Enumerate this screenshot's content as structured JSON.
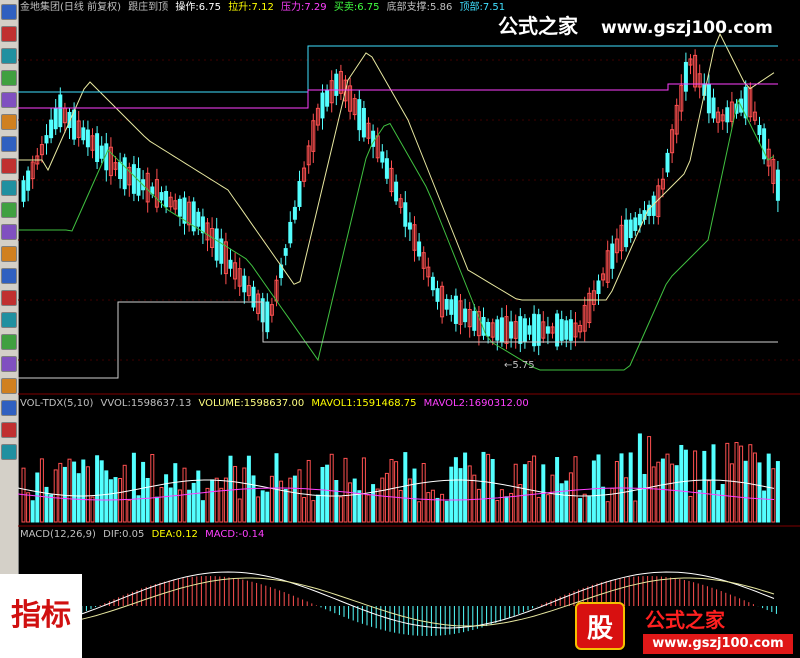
{
  "toolbar": {
    "icons": [
      "candlestick-icon",
      "trend-icon",
      "kline-icon",
      "bar-icon",
      "table-icon",
      "grid-icon",
      "note-icon",
      "people-icon",
      "chart-icon",
      "f10-icon",
      "report-icon",
      "info-icon",
      "news-icon",
      "sort-icon",
      "list-icon",
      "dollar-icon",
      "tools-icon",
      "exit-icon",
      "login-icon",
      "arrow-up-icon",
      "arrow-down-icon"
    ]
  },
  "main_header": {
    "stock": "金地集团(日线 前复权)",
    "indicator": "跟庄到顶",
    "operate": "操作:6.75",
    "pull": "拉升:7.12",
    "pressure": "压力:7.29",
    "buy": "买卖:6.75",
    "support": "底部支撑:5.86",
    "top": "顶部:7.51"
  },
  "volume_header": {
    "name": "VOL-TDX(5,10)",
    "vvol": "VVOL:1598637.13",
    "volume": "VOLUME:1598637.00",
    "mavol1": "MAVOL1:1591468.75",
    "mavol2": "MAVOL2:1690312.00"
  },
  "macd_header": {
    "name": "MACD(12,26,9)",
    "dif": "DIF:0.05",
    "dea": "DEA:0.12",
    "macd": "MACD:-0.14"
  },
  "annotation": "←5.75",
  "watermark_top": {
    "title": "公式之家",
    "url": "www.gszj100.com"
  },
  "watermark_bottom": {
    "badge": "股",
    "title": "公式之家",
    "url": "www.gszj100.com"
  },
  "seal_text": "指标",
  "colors": {
    "background": "#000000",
    "up": "#ff5050",
    "down": "#54ffff",
    "yellow_line": "#e8e8a0",
    "green_line": "#40c040",
    "magenta": "#ff40ff",
    "cyan_line": "#40e0ff",
    "white": "#ffffff"
  }
}
